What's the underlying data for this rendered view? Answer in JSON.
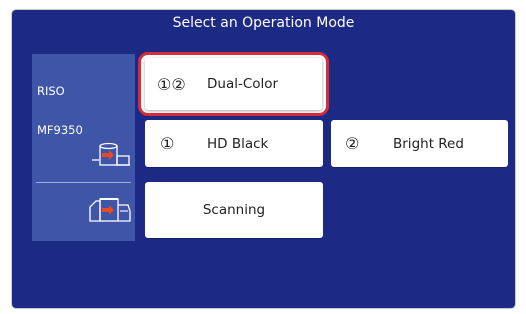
{
  "screen": {
    "title": "Select an Operation Mode",
    "background_color": "#1d2a85"
  },
  "device": {
    "brand": "RISO",
    "model": "MF9350",
    "panel_color": "#3e55a8",
    "icons": [
      "printer-icon",
      "scanner-printer-icon"
    ]
  },
  "modes": [
    {
      "number": "①②",
      "label": "Dual-Color",
      "selected": true
    },
    {
      "number": "①",
      "label": "HD Black",
      "selected": false
    },
    {
      "number": "②",
      "label": "Bright Red",
      "selected": false
    },
    {
      "number": "",
      "label": "Scanning",
      "selected": false
    }
  ],
  "colors": {
    "selection_ring": "#d72d3a",
    "button_bg": "#ffffff",
    "arrow_accent": "#e8491f"
  }
}
